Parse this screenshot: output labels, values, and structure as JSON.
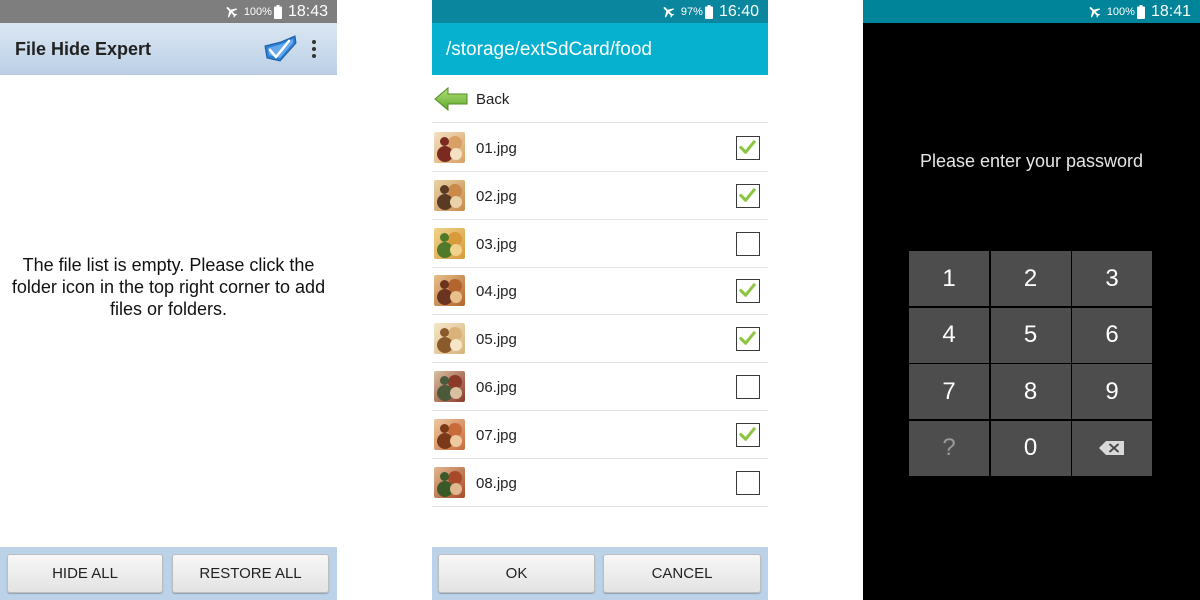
{
  "colors": {
    "s1_status": "#7e7e7e",
    "s2_status": "#0a879e",
    "s2_pathbar": "#06b1cf",
    "s3_status": "#00849a",
    "check_green": "#8cc63f",
    "keypad_key": "#4d4d4d"
  },
  "screen1": {
    "status": {
      "battery": "100%",
      "time": "18:43"
    },
    "app_title": "File Hide Expert",
    "icons": {
      "folder": "folder-check-icon",
      "overflow": "overflow-menu-icon"
    },
    "empty_message": "The file list is empty. Please click the folder icon in the top right corner to add files or folders.",
    "buttons": {
      "hide_all": "HIDE ALL",
      "restore_all": "RESTORE ALL"
    }
  },
  "screen2": {
    "status": {
      "battery": "97%",
      "time": "16:40"
    },
    "path": "/storage/extSdCard/food",
    "back_label": "Back",
    "files": [
      {
        "name": "01.jpg",
        "checked": true
      },
      {
        "name": "02.jpg",
        "checked": true
      },
      {
        "name": "03.jpg",
        "checked": false
      },
      {
        "name": "04.jpg",
        "checked": true
      },
      {
        "name": "05.jpg",
        "checked": true
      },
      {
        "name": "06.jpg",
        "checked": false
      },
      {
        "name": "07.jpg",
        "checked": true
      },
      {
        "name": "08.jpg",
        "checked": false
      }
    ],
    "buttons": {
      "ok": "OK",
      "cancel": "CANCEL"
    }
  },
  "screen3": {
    "status": {
      "battery": "100%",
      "time": "18:41"
    },
    "prompt": "Please enter your password",
    "keys": [
      "1",
      "2",
      "3",
      "4",
      "5",
      "6",
      "7",
      "8",
      "9",
      "?",
      "0",
      "backspace-icon"
    ]
  }
}
